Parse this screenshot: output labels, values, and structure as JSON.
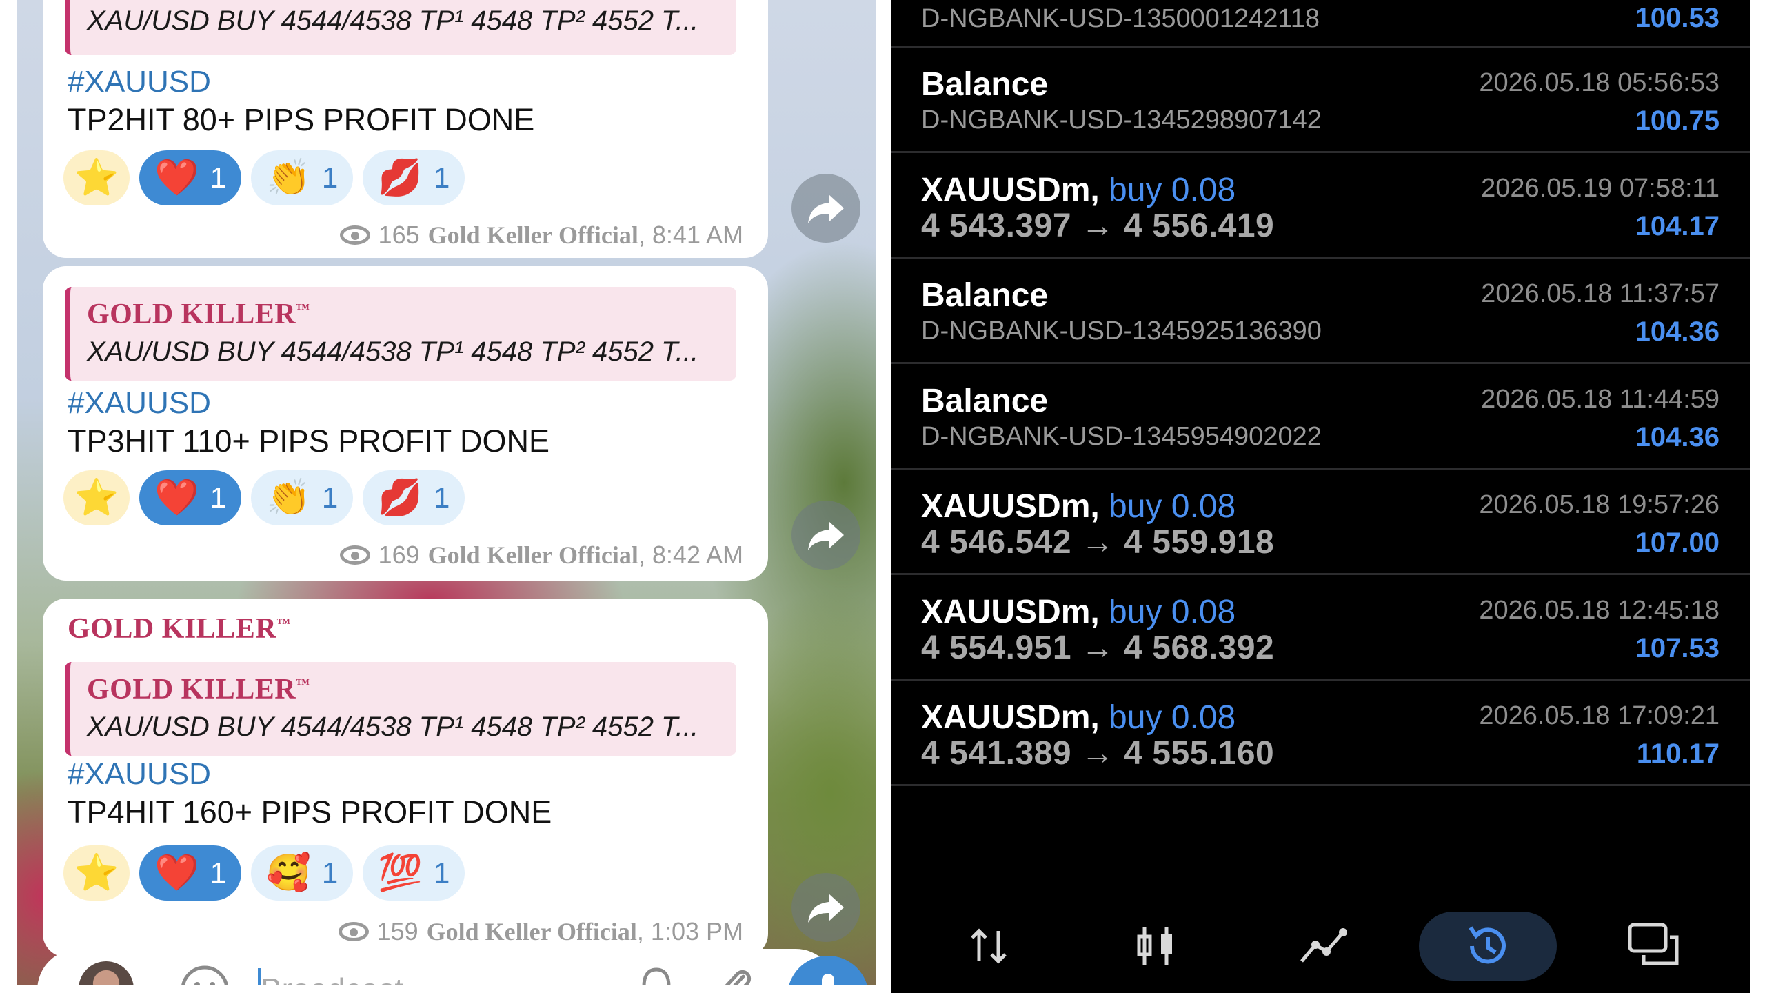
{
  "telegram": {
    "channel_tag": "GOLD KILLER",
    "trademark": "™",
    "reply_text": "XAU/USD BUY 4544/4538  TP¹ 4548 TP² 4552 T...",
    "messages": [
      {
        "tag": "#XAUUSD",
        "text": "TP2HIT 80+ PIPS PROFIT DONE",
        "views": "165",
        "author": "Gold Keller Official",
        "time": ", 8:41 AM",
        "reactions": [
          {
            "emoji": "⭐"
          },
          {
            "emoji": "❤️",
            "count": "1"
          },
          {
            "emoji": "👏",
            "count": "1"
          },
          {
            "emoji": "💋",
            "count": "1"
          }
        ]
      },
      {
        "tag": "#XAUUSD",
        "text": "TP3HIT 110+ PIPS PROFIT DONE",
        "views": "169",
        "author": "Gold Keller Official",
        "time": ", 8:42 AM",
        "reactions": [
          {
            "emoji": "⭐"
          },
          {
            "emoji": "❤️",
            "count": "1"
          },
          {
            "emoji": "👏",
            "count": "1"
          },
          {
            "emoji": "💋",
            "count": "1"
          }
        ]
      },
      {
        "tag": "#XAUUSD",
        "text": "TP4HIT 160+ PIPS PROFIT DONE",
        "views": "159",
        "author": "Gold Keller Official",
        "time": ", 1:03 PM",
        "reactions": [
          {
            "emoji": "⭐"
          },
          {
            "emoji": "❤️",
            "count": "1"
          },
          {
            "emoji": "🥰",
            "count": "1"
          },
          {
            "emoji": "💯",
            "count": "1"
          }
        ]
      }
    ],
    "compose_placeholder": "Broadcast"
  },
  "history": {
    "top_partial": {
      "sub": "D-NGBANK-USD-1350001242118",
      "amount": "100.53"
    },
    "rows": [
      {
        "title": "Balance",
        "type": "",
        "sub": "D-NGBANK-USD-1345298907142",
        "date": "2026.05.18 05:56:53",
        "amount": "100.75"
      },
      {
        "title": "XAUUSDm,",
        "type": "buy 0.08",
        "sub": "4 543.397 → 4 556.419",
        "date": "2026.05.19 07:58:11",
        "amount": "104.17"
      },
      {
        "title": "Balance",
        "type": "",
        "sub": "D-NGBANK-USD-1345925136390",
        "date": "2026.05.18 11:37:57",
        "amount": "104.36"
      },
      {
        "title": "Balance",
        "type": "",
        "sub": "D-NGBANK-USD-1345954902022",
        "date": "2026.05.18 11:44:59",
        "amount": "104.36"
      },
      {
        "title": "XAUUSDm,",
        "type": "buy 0.08",
        "sub": "4 546.542 → 4 559.918",
        "date": "2026.05.18 19:57:26",
        "amount": "107.00"
      },
      {
        "title": "XAUUSDm,",
        "type": "buy 0.08",
        "sub": "4 554.951 → 4 568.392",
        "date": "2026.05.18 12:45:18",
        "amount": "107.53"
      },
      {
        "title": "XAUUSDm,",
        "type": "buy 0.08",
        "sub": "4 541.389 → 4 555.160",
        "date": "2026.05.18 17:09:21",
        "amount": "110.17"
      }
    ],
    "nav": [
      "quotes-icon",
      "chart-icon",
      "trade-icon",
      "history-icon",
      "messages-icon"
    ],
    "active_nav": "history-icon",
    "colors": {
      "accent": "#4a8ff0",
      "background": "#000000"
    }
  }
}
